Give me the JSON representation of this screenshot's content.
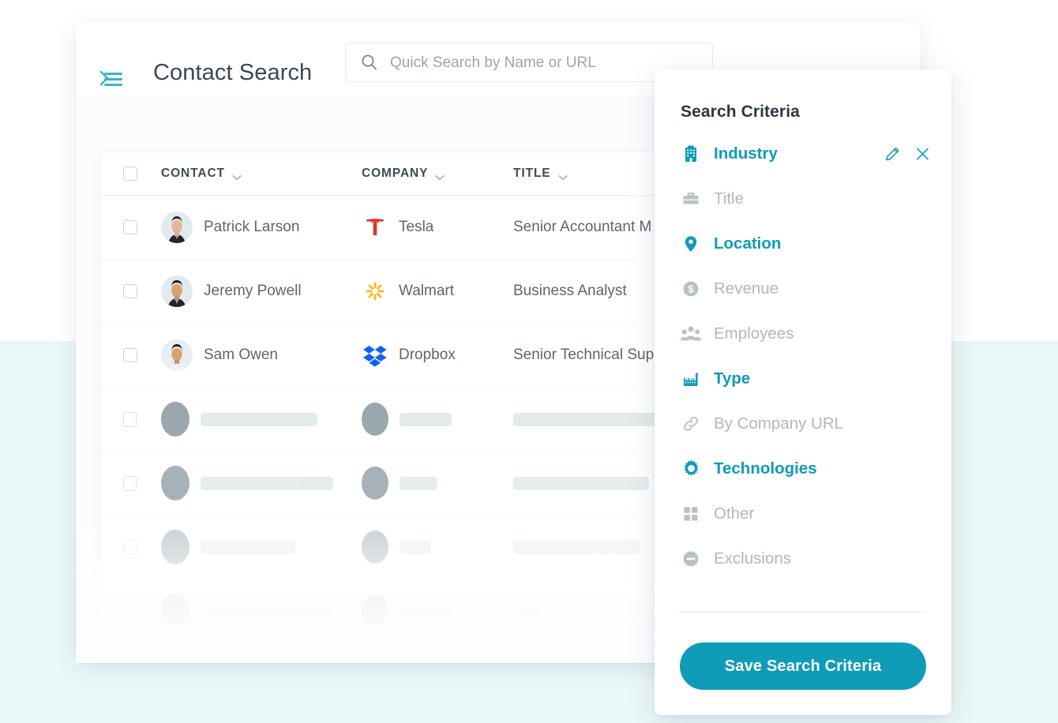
{
  "header": {
    "menu_icon": "hamburger-icon",
    "chevron_icon": "chevron-right-icon",
    "title": "Contact Search",
    "search": {
      "icon": "search-icon",
      "value": "",
      "placeholder": "Quick Search by Name or URL"
    }
  },
  "table": {
    "select_all_checkbox": "checkbox",
    "columns": [
      {
        "label": "CONTACT",
        "sort_icon": "chevron-down-icon"
      },
      {
        "label": "COMPANY",
        "sort_icon": "chevron-down-icon"
      },
      {
        "label": "TITLE",
        "sort_icon": "chevron-down-icon"
      }
    ],
    "rows": [
      {
        "contact": "Patrick Larson",
        "company": "Tesla",
        "title": "Senior Accountant M",
        "logo": "tesla-logo",
        "avatar": "avatar-photo"
      },
      {
        "contact": "Jeremy Powell",
        "company": "Walmart",
        "title": "Business Analyst",
        "logo": "walmart-logo",
        "avatar": "avatar-photo"
      },
      {
        "contact": "Sam Owen",
        "company": "Dropbox",
        "title": "Senior Technical Sup",
        "logo": "dropbox-logo",
        "avatar": "avatar-photo"
      }
    ],
    "placeholder_rows": [
      {
        "name_w": 148,
        "company_w": 66,
        "title_w": 196,
        "opacity": 1.0
      },
      {
        "name_w": 168,
        "company_w": 48,
        "title_w": 172,
        "opacity": 0.88
      },
      {
        "name_w": 120,
        "company_w": 40,
        "title_w": 160,
        "opacity": 0.62
      },
      {
        "name_w": 166,
        "company_w": 66,
        "title_w": 34,
        "opacity": 0.34
      },
      {
        "name_w": 150,
        "company_w": 62,
        "title_w": 120,
        "opacity": 0.12
      }
    ]
  },
  "criteria_panel": {
    "title": "Search Criteria",
    "items": [
      {
        "label": "Industry",
        "icon": "building-icon",
        "state": "active",
        "has_actions": true
      },
      {
        "label": "Title",
        "icon": "briefcase-icon",
        "state": "inactive",
        "has_actions": false
      },
      {
        "label": "Location",
        "icon": "map-pin-icon",
        "state": "active",
        "has_actions": false
      },
      {
        "label": "Revenue",
        "icon": "dollar-circle-icon",
        "state": "inactive",
        "has_actions": false
      },
      {
        "label": "Employees",
        "icon": "people-icon",
        "state": "inactive",
        "has_actions": false
      },
      {
        "label": "Type",
        "icon": "factory-icon",
        "state": "active",
        "has_actions": false
      },
      {
        "label": "By Company URL",
        "icon": "link-icon",
        "state": "inactive",
        "has_actions": false
      },
      {
        "label": "Technologies",
        "icon": "gear-icon",
        "state": "active",
        "has_actions": false
      },
      {
        "label": "Other",
        "icon": "grid-icon",
        "state": "inactive",
        "has_actions": false
      },
      {
        "label": "Exclusions",
        "icon": "minus-circle-icon",
        "state": "inactive",
        "has_actions": false
      }
    ],
    "row_actions": {
      "edit_icon": "pencil-icon",
      "remove_icon": "close-icon"
    },
    "save_label": "Save Search Criteria"
  },
  "colors": {
    "accent_teal": "#0e9cb8",
    "hamburger_teal": "#35b5c8",
    "muted_text": "#aeb8bf",
    "body_text": "#5b6670",
    "header_text": "#3b4754",
    "mint_band": "#eaf7f8",
    "tesla_red": "#e62e24",
    "walmart_yellow": "#ffb71b",
    "dropbox_blue": "#0d62f5"
  }
}
